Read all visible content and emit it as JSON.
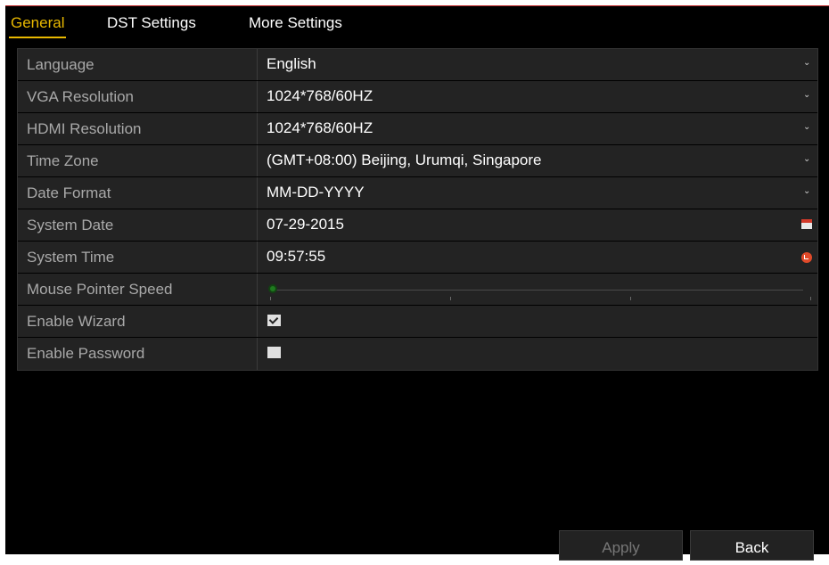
{
  "tabs": [
    {
      "label": "General",
      "active": true
    },
    {
      "label": "DST Settings",
      "active": false
    },
    {
      "label": "More Settings",
      "active": false
    }
  ],
  "form": {
    "language": {
      "label": "Language",
      "value": "English"
    },
    "vga_resolution": {
      "label": "VGA Resolution",
      "value": "1024*768/60HZ"
    },
    "hdmi_resolution": {
      "label": "HDMI Resolution",
      "value": "1024*768/60HZ"
    },
    "time_zone": {
      "label": "Time Zone",
      "value": "(GMT+08:00) Beijing, Urumqi, Singapore"
    },
    "date_format": {
      "label": "Date Format",
      "value": "MM-DD-YYYY"
    },
    "system_date": {
      "label": "System Date",
      "value": "07-29-2015",
      "icon": "calendar-icon"
    },
    "system_time": {
      "label": "System Time",
      "value": "09:57:55",
      "icon": "clock-icon"
    },
    "mouse_pointer_speed": {
      "label": "Mouse Pointer Speed",
      "level": 0
    },
    "enable_wizard": {
      "label": "Enable Wizard",
      "checked": true
    },
    "enable_password": {
      "label": "Enable Password",
      "checked": false
    }
  },
  "buttons": {
    "apply": "Apply",
    "back": "Back"
  },
  "colors": {
    "active_tab": "#e8b800",
    "row_bg": "#232323",
    "label_text": "#a9a9a9",
    "value_text": "#ffffff",
    "accent_border": "#c0282a"
  }
}
